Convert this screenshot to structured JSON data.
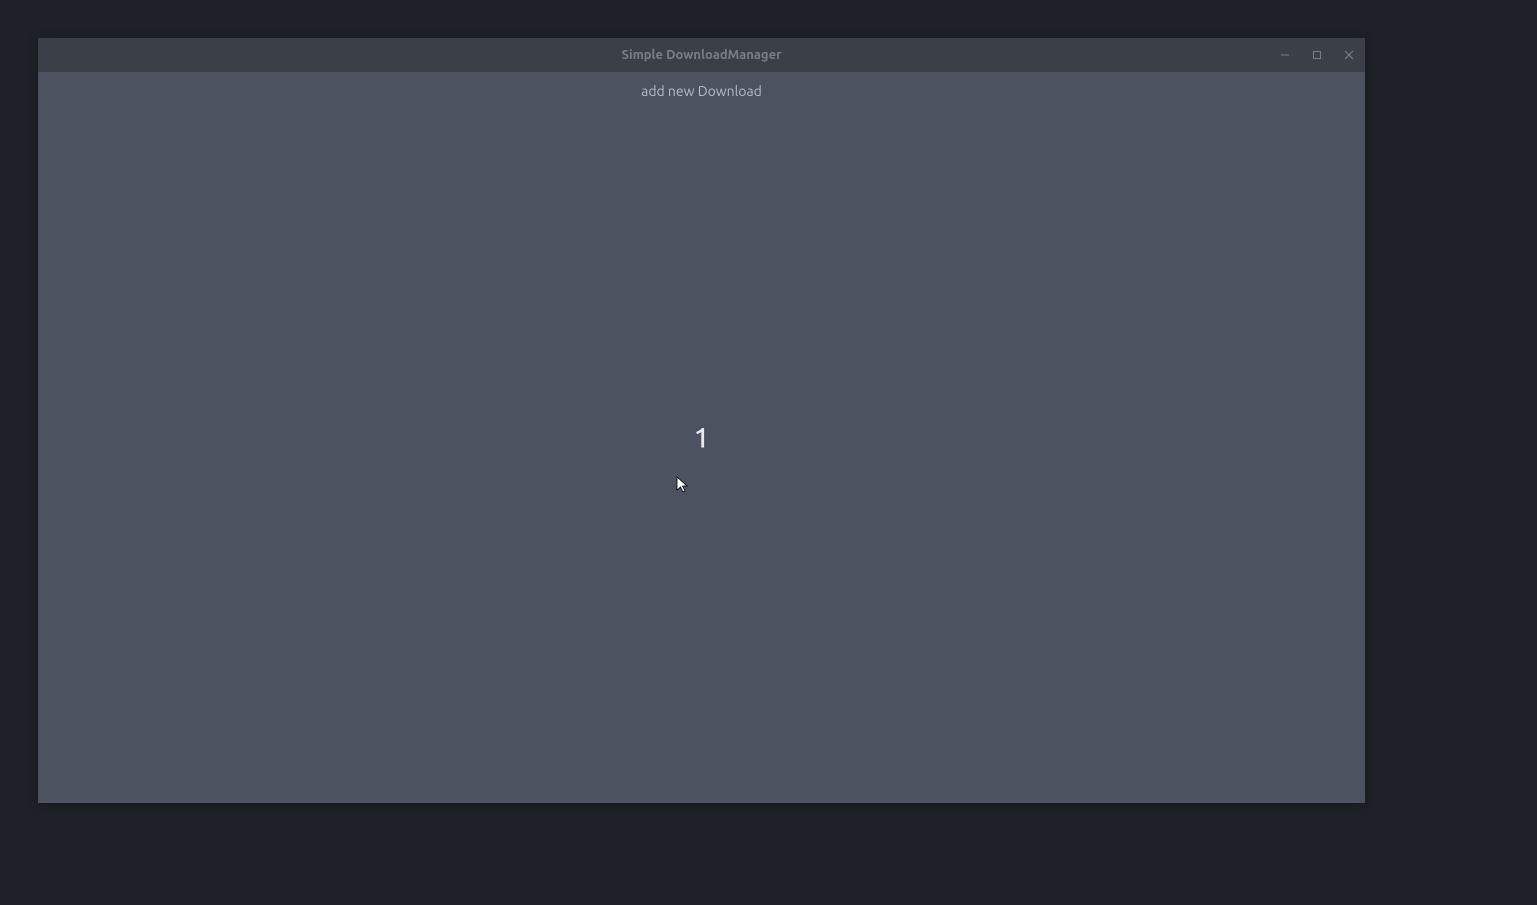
{
  "window": {
    "title": "Simple DownloadManager"
  },
  "toolbar": {
    "add_download_label": "add new Download"
  },
  "content": {
    "center_value": "1"
  }
}
